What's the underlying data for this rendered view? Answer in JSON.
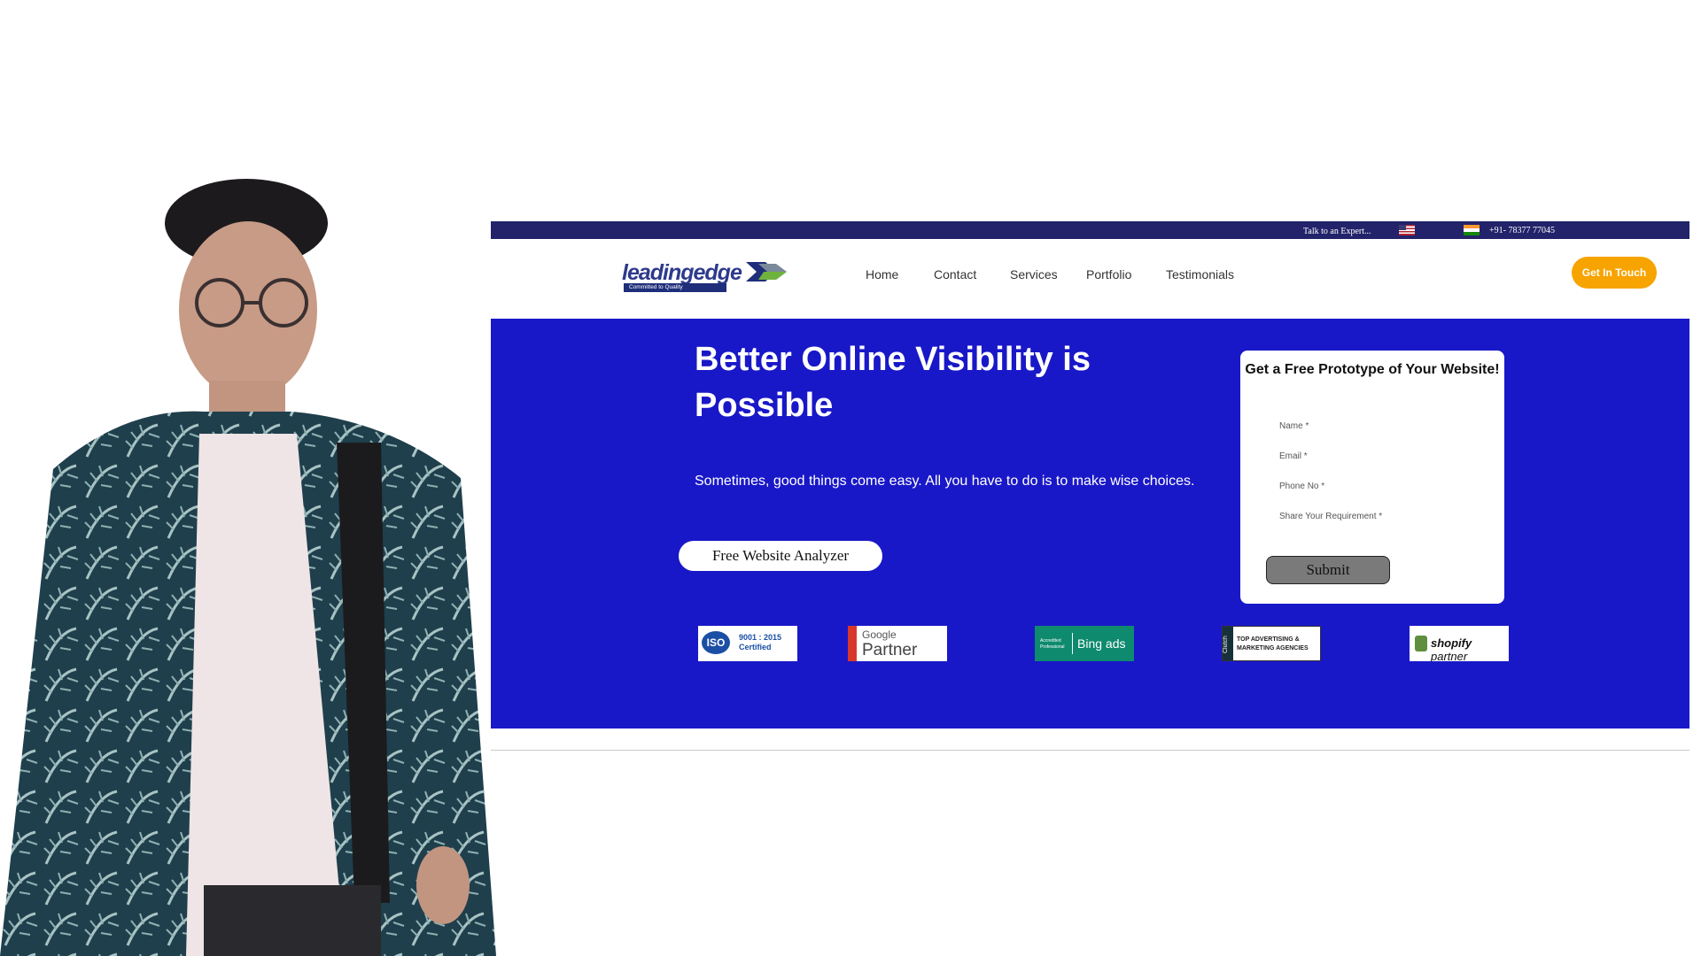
{
  "topbar": {
    "talk_label": "Talk to an Expert...",
    "phone": "+91- 78377 77045"
  },
  "logo": {
    "brand": "leadingedge",
    "tagline": "Committed to Quality"
  },
  "nav": {
    "links": [
      "Home",
      "Contact",
      "Services",
      "Portfolio",
      "Testimonials"
    ],
    "cta_label": "Get In Touch"
  },
  "hero": {
    "title": "Better Online Visibility is Possible",
    "subtitle": "Sometimes, good things come easy. All you have to do is to make wise choices.",
    "analyzer_label": "Free Website Analyzer"
  },
  "form": {
    "title": "Get a Free Prototype of Your Website!",
    "name_placeholder": "Name *",
    "email_placeholder": "Email *",
    "phone_placeholder": "Phone No *",
    "requirement_placeholder": "Share Your Requirement *",
    "submit_label": "Submit"
  },
  "badges": {
    "iso_mark": "ISO",
    "iso_line1": "9001 : 2015",
    "iso_line2": "Certified",
    "google_brand": "Google",
    "google_text": "Partner",
    "bing_accredited": "Accredited Professional",
    "bing_text": "Bing ads",
    "clutch_side": "Clutch",
    "clutch_line1": "TOP ADVERTISING &",
    "clutch_line2": "MARKETING AGENCIES",
    "shopify_brand": "shopify",
    "shopify_text": "partner"
  },
  "colors": {
    "topbar": "#22236a",
    "hero": "#1918c8",
    "cta": "#f7a300",
    "submit": "#7a7a7a"
  }
}
